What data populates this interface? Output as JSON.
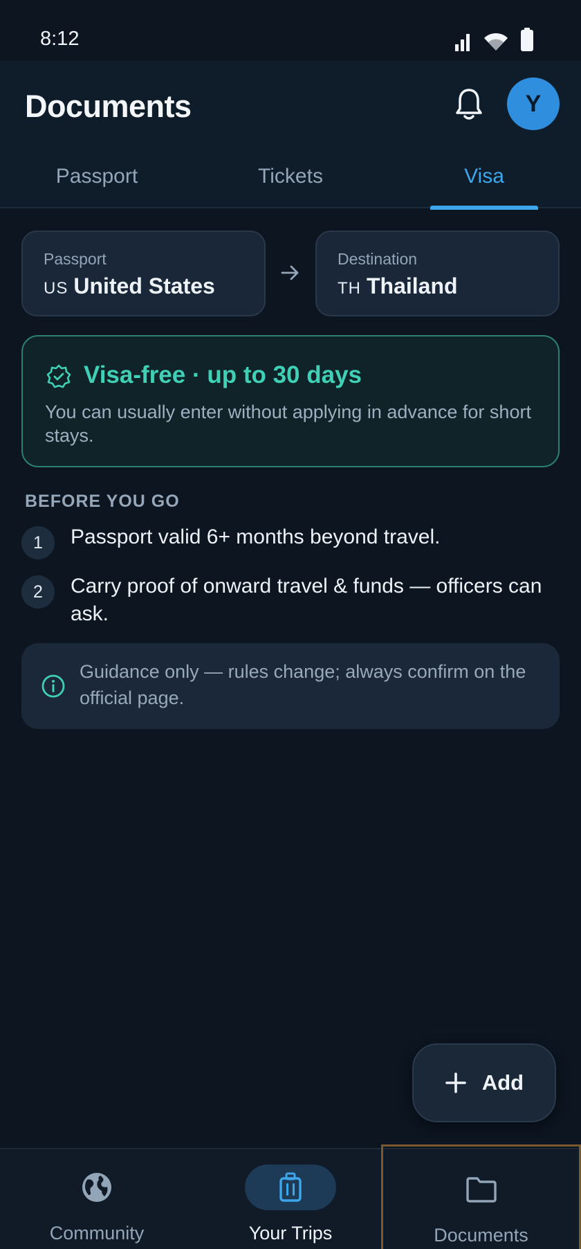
{
  "status_bar": {
    "time": "8:12"
  },
  "header": {
    "title": "Documents",
    "avatar_initial": "Y"
  },
  "tabs": [
    {
      "label": "Passport",
      "active": false
    },
    {
      "label": "Tickets",
      "active": false
    },
    {
      "label": "Visa",
      "active": true
    }
  ],
  "route": {
    "passport": {
      "label": "Passport",
      "code": "US",
      "country": "United States"
    },
    "destination": {
      "label": "Destination",
      "code": "TH",
      "country": "Thailand"
    }
  },
  "visa_status": {
    "headline": "Visa-free · up to 30 days",
    "description": "You can usually enter without applying in advance for short stays.",
    "color": "#3fd0b5"
  },
  "checklist": {
    "heading": "BEFORE YOU GO",
    "items": [
      {
        "number": "1",
        "text": "Passport valid 6+ months beyond travel."
      },
      {
        "number": "2",
        "text": "Carry proof of onward travel & funds — officers can ask."
      }
    ]
  },
  "notice": {
    "text": "Guidance only — rules change; always confirm on the official page."
  },
  "fab": {
    "label": "Add"
  },
  "bottom_nav": [
    {
      "label": "Community",
      "icon": "globe-icon"
    },
    {
      "label": "Your Trips",
      "icon": "luggage-icon",
      "active": true
    },
    {
      "label": "Documents",
      "icon": "folder-icon"
    }
  ],
  "colors": {
    "accent": "#3ea7ec",
    "success": "#3fd0b5",
    "background": "#0c1520"
  }
}
